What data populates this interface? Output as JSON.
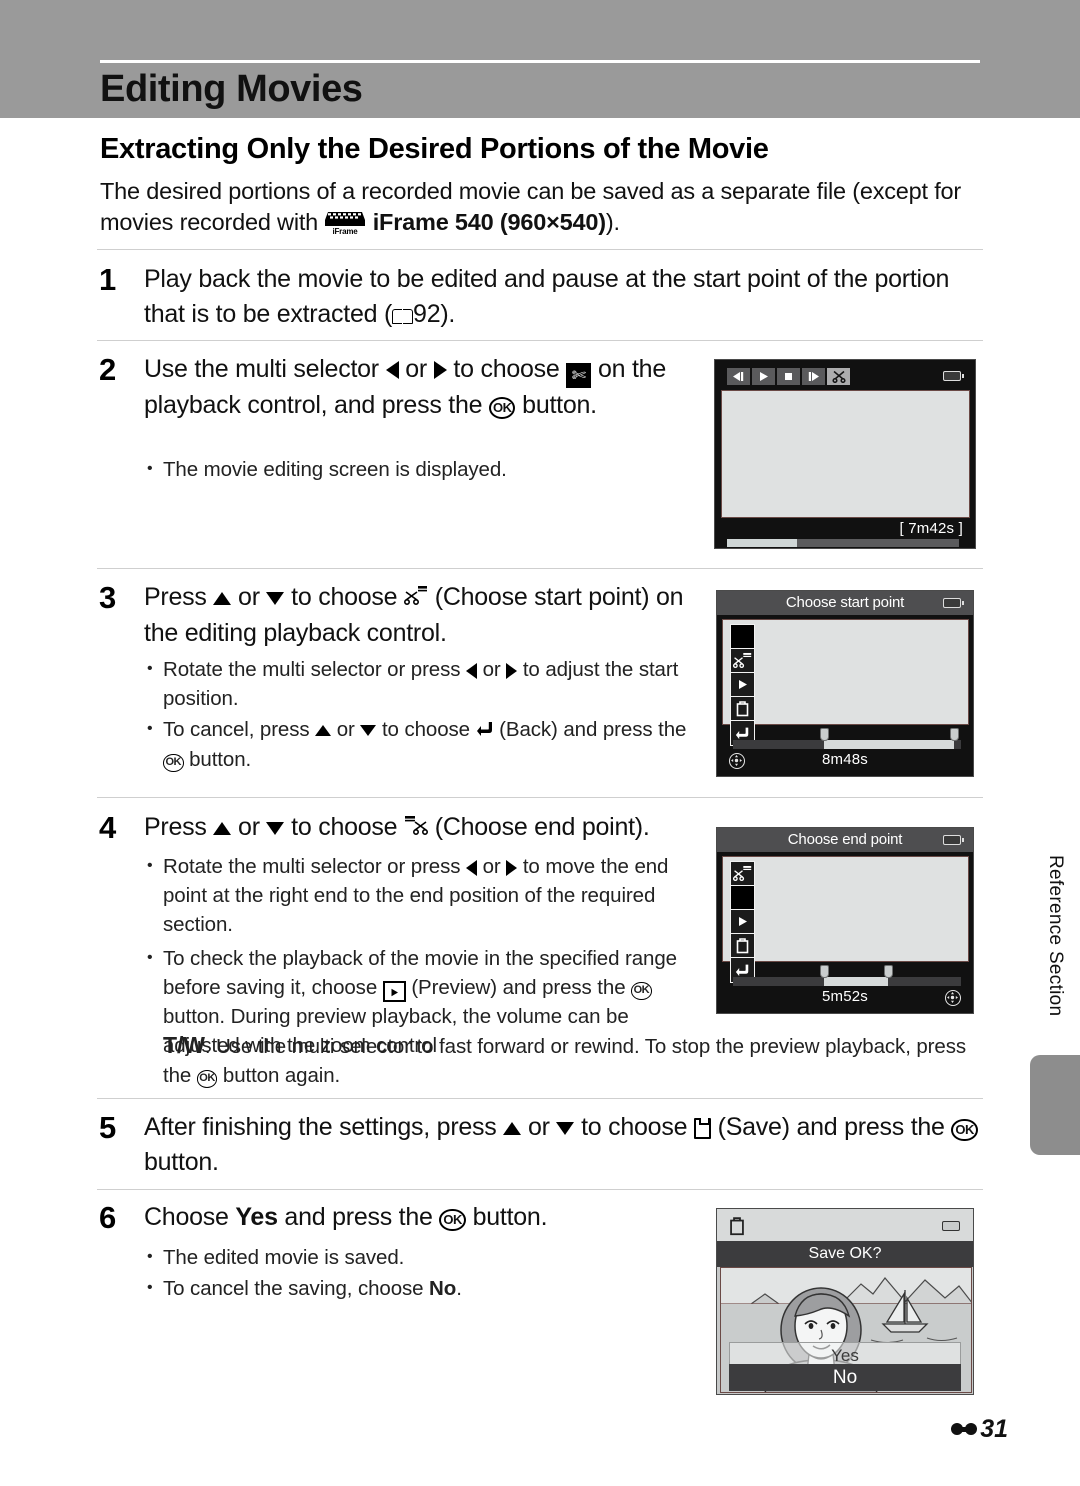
{
  "header": {
    "title": "Editing Movies"
  },
  "section": {
    "heading": "Extracting Only the Desired Portions of the Movie",
    "intro_before": "The desired portions of a recorded movie can be saved as a separate file (except for movies recorded with ",
    "intro_icon": "iframe-movie-icon",
    "intro_bold": "iFrame 540 (960×540)",
    "intro_after": ")."
  },
  "steps": [
    {
      "number": "1",
      "text_a": "Play back the movie to be edited and pause at the start point of the portion that is to be extracted (",
      "ref_page": "92",
      "text_b": ").",
      "bullets": []
    },
    {
      "number": "2",
      "text_a": "Use the multi selector ",
      "text_b": " or ",
      "text_c": " to choose ",
      "text_d": " on the playback control, and press the ",
      "text_e": " button.",
      "bullets": [
        "The movie editing screen is displayed."
      ]
    },
    {
      "number": "3",
      "text_a": "Press ",
      "text_b": " or ",
      "text_c": " to choose ",
      "text_d": " (Choose start point) on the editing playback control.",
      "bullet1_a": "Rotate the multi selector or press ",
      "bullet1_b": " or ",
      "bullet1_c": " to adjust the start position.",
      "bullet2_a": "To cancel, press ",
      "bullet2_b": " or ",
      "bullet2_c": " to choose ",
      "bullet2_d": " (Back) and press the ",
      "bullet2_e": " button."
    },
    {
      "number": "4",
      "text_a": "Press ",
      "text_b": " or ",
      "text_c": " to choose ",
      "text_d": " (Choose end point).",
      "bullet1_a": "Rotate the multi selector or press ",
      "bullet1_b": " or ",
      "bullet1_c": " to move the end point at the right end to the end position of the required section.",
      "bullet2_a": "To check the playback of the movie in the specified range before saving it, choose ",
      "bullet2_b": " (Preview) and press the ",
      "bullet2_c": " button. During preview playback, the volume can be adjusted with the zoom control ",
      "bullet2_zoom": "T/W",
      "bullet2_d": ". Use the multi selector to fast forward or rewind. To stop the preview playback, press the ",
      "bullet2_e": " button again."
    },
    {
      "number": "5",
      "text_a": "After finishing the settings, press ",
      "text_b": " or ",
      "text_c": " to choose ",
      "text_d": " (Save) and press the ",
      "text_e": " button.",
      "bullets": []
    },
    {
      "number": "6",
      "text_a": "Choose ",
      "text_bold_yes": "Yes",
      "text_b": " and press the ",
      "text_c": " button.",
      "bullet1": "The edited movie is saved.",
      "bullet2_a": "To cancel the saving, choose ",
      "bullet2_bold_no": "No",
      "bullet2_b": "."
    }
  ],
  "screens": {
    "movie_edit": {
      "name": "movie-editing-screen",
      "controls": [
        "frame-rewind-icon",
        "play-icon",
        "stop-icon",
        "frame-forward-icon",
        "scissors-icon"
      ],
      "selected_control": "scissors-icon",
      "duration": "[   7m42s ]",
      "progress_percent": 30,
      "battery": "battery-icon"
    },
    "start_point": {
      "name": "choose-start-point-screen",
      "title": "Choose start point",
      "icons": [
        "selected-block",
        "choose-start-point-icon",
        "preview-play-icon",
        "save-icon",
        "back-icon"
      ],
      "selected_index": 0,
      "time": "8m48s",
      "handle_left_percent": 40,
      "handle_right_percent": 97,
      "fill_percent": 40,
      "battery": "battery-icon",
      "multi_selector": "multi-selector-icon"
    },
    "end_point": {
      "name": "choose-end-point-screen",
      "title": "Choose end point",
      "icons": [
        "choose-start-point-icon",
        "selected-block",
        "preview-play-icon",
        "save-icon",
        "back-icon"
      ],
      "selected_index": 1,
      "time": "5m52s",
      "handle_left_percent": 40,
      "handle_right_percent": 68,
      "battery": "battery-icon",
      "multi_selector": "multi-selector-icon"
    },
    "save_confirm": {
      "name": "save-confirmation-screen",
      "header_icon": "save-icon",
      "prompt": "Save OK?",
      "option_yes": "Yes",
      "option_no": "No",
      "selected_option": "No",
      "battery": "battery-icon"
    }
  },
  "side_tab": {
    "label": "Reference Section"
  },
  "footer": {
    "page_number": "31"
  }
}
